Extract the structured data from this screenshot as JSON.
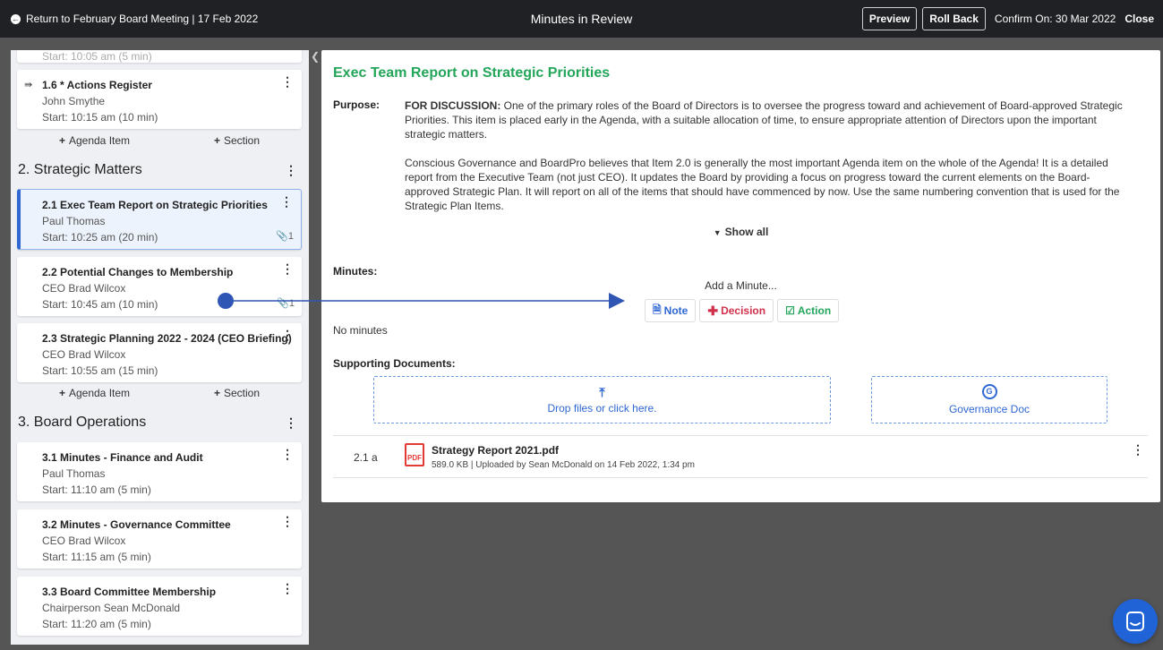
{
  "topbar": {
    "back_label": "Return to February Board Meeting | 17 Feb 2022",
    "title": "Minutes in Review",
    "preview_label": "Preview",
    "rollback_label": "Roll Back",
    "confirm_text": "Confirm On: 30 Mar 2022",
    "close_label": "Close"
  },
  "agenda": {
    "add_item_label": "Agenda Item",
    "add_section_label": "Section",
    "top_partial_line": "Start: 10:05 am (5 min)",
    "items_s1": [
      {
        "title": "1.6 * Actions Register",
        "owner": "John Smythe",
        "start": "Start: 10:15 am (10 min)"
      }
    ],
    "sections": [
      {
        "title": "2. Strategic Matters"
      },
      {
        "title": "3. Board Operations"
      }
    ],
    "items_s2": [
      {
        "title": "2.1 Exec Team Report on Strategic Priorities",
        "owner": "Paul Thomas",
        "start": "Start: 10:25 am (20 min)",
        "attachments": "1"
      },
      {
        "title": "2.2 Potential Changes to Membership",
        "owner": "CEO Brad Wilcox",
        "start": "Start: 10:45 am (10 min)",
        "attachments": "1"
      },
      {
        "title": "2.3 Strategic Planning 2022 - 2024 (CEO Briefing)",
        "owner": "CEO Brad Wilcox",
        "start": "Start: 10:55 am (15 min)"
      }
    ],
    "items_s3": [
      {
        "title": "3.1 Minutes - Finance and Audit",
        "owner": "Paul Thomas",
        "start": "Start: 11:10 am (5 min)"
      },
      {
        "title": "3.2 Minutes - Governance Committee",
        "owner": "CEO Brad Wilcox",
        "start": "Start: 11:15 am (5 min)"
      },
      {
        "title": "3.3 Board Committee Membership",
        "owner": "Chairperson Sean McDonald",
        "start": "Start: 11:20 am (5 min)"
      }
    ]
  },
  "detail": {
    "title": "Exec Team Report on Strategic Priorities",
    "purpose_label": "Purpose:",
    "purpose_lead": "FOR DISCUSSION:",
    "purpose_p1": " One of the primary roles of the Board of Directors is to oversee the progress toward and achievement of Board-approved Strategic Priorities. This item is placed early in the Agenda, with a suitable allocation of time, to ensure appropriate attention of Directors upon the important strategic matters.",
    "purpose_p2": "Conscious Governance and BoardPro believes that Item 2.0 is generally the most important Agenda item on the whole of the Agenda! It is a detailed report from the Executive Team (not just CEO). It updates the Board by providing a focus on progress toward the current elements on the Board-approved Strategic Plan. It will report on all of the items that should have commenced by now. Use the same numbering convention that is used for the Strategic Plan Items.",
    "show_all_label": "Show all",
    "minutes_label": "Minutes:",
    "add_minute_label": "Add a Minute...",
    "note_label": "Note",
    "decision_label": "Decision",
    "action_label": "Action",
    "no_minutes_text": "No minutes",
    "supporting_label": "Supporting Documents:",
    "drop_label": "Drop files or click here.",
    "gov_doc_label": "Governance Doc",
    "document": {
      "ref": "2.1 a",
      "name": "Strategy Report 2021.pdf",
      "meta": "589.0 KB | Uploaded by Sean McDonald on 14 Feb 2022, 1:34 pm"
    }
  },
  "colors": {
    "accent_green": "#23a55a",
    "accent_blue": "#2f67d3",
    "decision_red": "#d0304a"
  }
}
